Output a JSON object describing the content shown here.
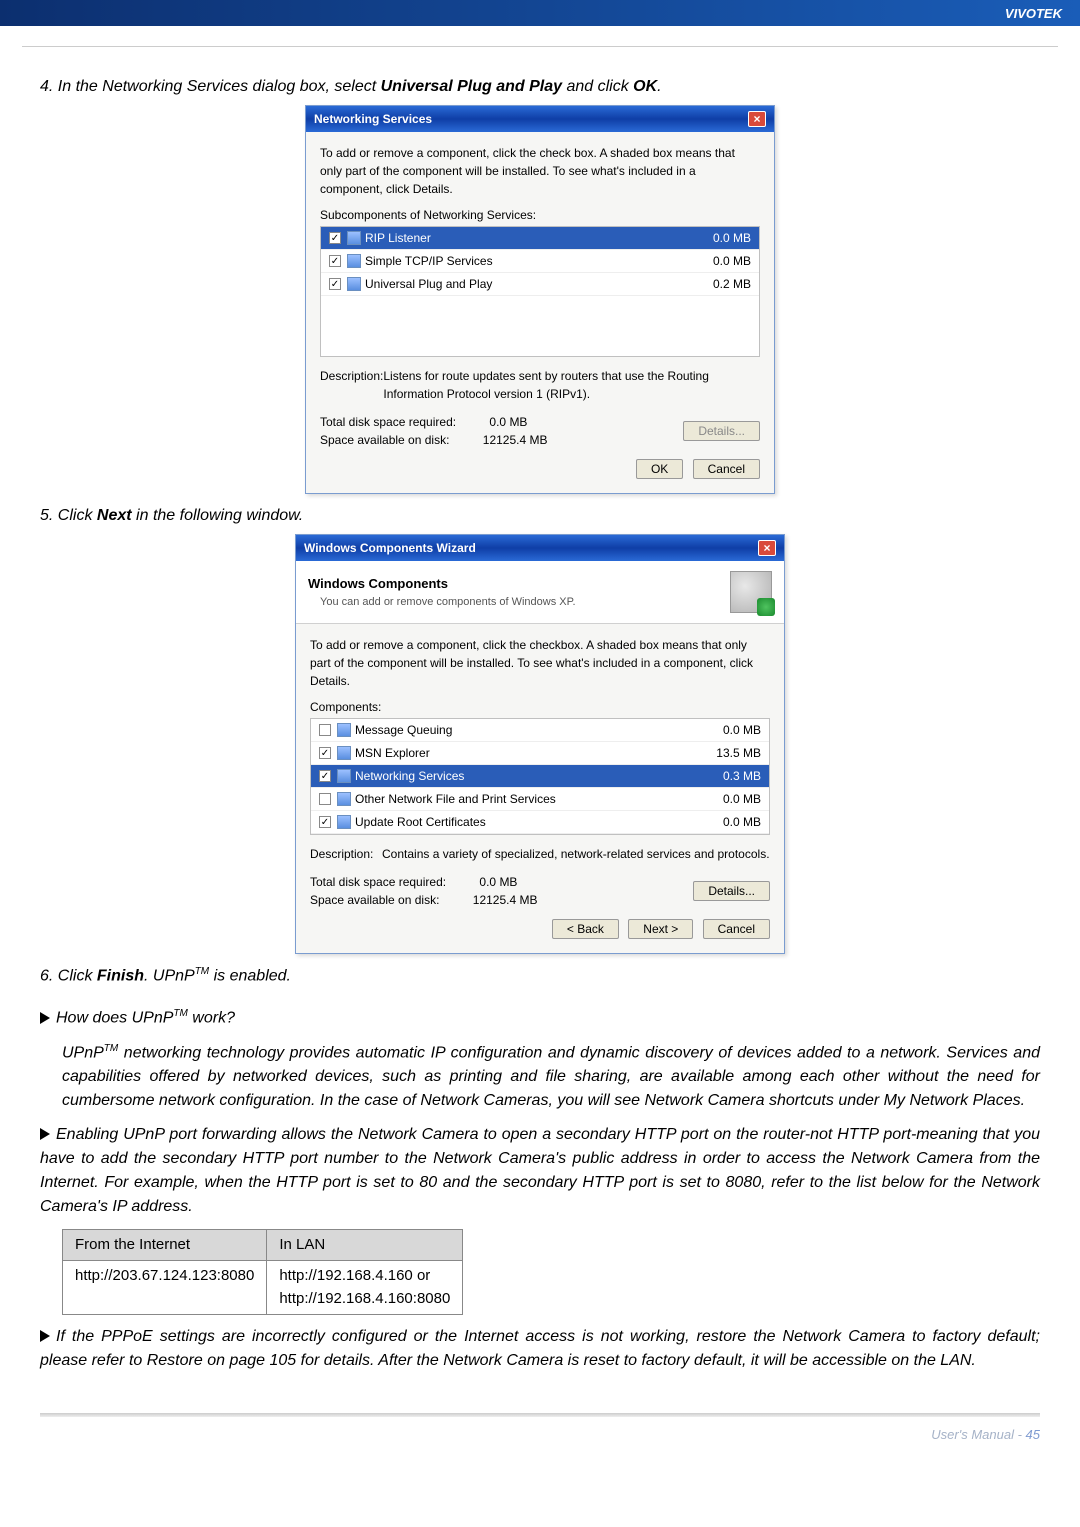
{
  "brand": "VIVOTEK",
  "step4": "4. In the Networking Services dialog box, select ",
  "step4_bold": "Universal Plug and Play",
  "step4_tail": " and click ",
  "step4_ok": "OK",
  "step4_period": ".",
  "netdlg": {
    "title": "Networking Services",
    "desc": "To add or remove a component, click the check box. A shaded box means that only part of the component will be installed. To see what's included in a component, click Details.",
    "sub_label": "Subcomponents of Networking Services:",
    "rows": [
      {
        "label": "RIP Listener",
        "size": "0.0 MB",
        "selected": true
      },
      {
        "label": "Simple TCP/IP Services",
        "size": "0.0 MB",
        "selected": false
      },
      {
        "label": "Universal Plug and Play",
        "size": "0.2 MB",
        "selected": false
      }
    ],
    "desc2_label": "Description:",
    "desc2": "Listens for route updates sent by routers that use the Routing Information Protocol version 1 (RIPv1).",
    "total_label": "Total disk space required:",
    "total_val": "0.0 MB",
    "avail_label": "Space available on disk:",
    "avail_val": "12125.4 MB",
    "details_btn": "Details...",
    "ok_btn": "OK",
    "cancel_btn": "Cancel"
  },
  "step5": "5. Click ",
  "step5_bold": "Next",
  "step5_tail": " in the following window.",
  "wiz": {
    "title": "Windows Components Wizard",
    "head_title": "Windows Components",
    "head_sub": "You can add or remove components of Windows XP.",
    "desc": "To add or remove a component, click the checkbox. A shaded box means that only part of the component will be installed. To see what's included in a component, click Details.",
    "comp_label": "Components:",
    "rows": [
      {
        "label": "Message Queuing",
        "size": "0.0 MB",
        "checked": false
      },
      {
        "label": "MSN Explorer",
        "size": "13.5 MB",
        "checked": true
      },
      {
        "label": "Networking Services",
        "size": "0.3 MB",
        "checked": true,
        "selected": true
      },
      {
        "label": "Other Network File and Print Services",
        "size": "0.0 MB",
        "checked": false
      },
      {
        "label": "Update Root Certificates",
        "size": "0.0 MB",
        "checked": true
      }
    ],
    "desc2_label": "Description:",
    "desc2": "Contains a variety of specialized, network-related services and protocols.",
    "total_label": "Total disk space required:",
    "total_val": "0.0 MB",
    "avail_label": "Space available on disk:",
    "avail_val": "12125.4 MB",
    "details_btn": "Details...",
    "back_btn": "< Back",
    "next_btn": "Next >",
    "cancel_btn": "Cancel"
  },
  "step6_a": "6. Click ",
  "step6_bold": "Finish",
  "step6_b": ". UPnP",
  "step6_tm": "TM",
  "step6_c": " is enabled.",
  "howdoes_a": "How does UPnP",
  "howdoes_tm": "TM",
  "howdoes_b": " work?",
  "howdoes_body_a": "UPnP",
  "howdoes_body_tm": "TM",
  "howdoes_body_b": " networking technology provides automatic IP configuration and dynamic discovery of devices added to a network. Services and capabilities offered by networked devices, such as printing and file sharing, are available among each other without the need for cumbersome network configuration. In the case of Network Cameras, you will see Network Camera shortcuts under My Network Places.",
  "enabling": "Enabling UPnP port forwarding allows the Network Camera to open a secondary HTTP port on the router-not HTTP port-meaning that you have to add the secondary HTTP port number to the Network Camera's public address in order to access the Network Camera from the Internet. For example, when the HTTP port is set to 80 and the secondary HTTP port is set to 8080, refer to the list below for the Network Camera's IP address.",
  "table": {
    "h1": "From the Internet",
    "h2": "In LAN",
    "r1c1": "http://203.67.124.123:8080",
    "r1c2a": "http://192.168.4.160 or",
    "r1c2b": "http://192.168.4.160:8080"
  },
  "pppoe": "If the PPPoE settings are incorrectly configured or the Internet access is not working, restore the Network Camera to factory default; please refer to Restore on page 105 for details. After the Network Camera is reset to factory default, it will be accessible on the LAN.",
  "footer": "User's Manual -",
  "pagenum": "45"
}
